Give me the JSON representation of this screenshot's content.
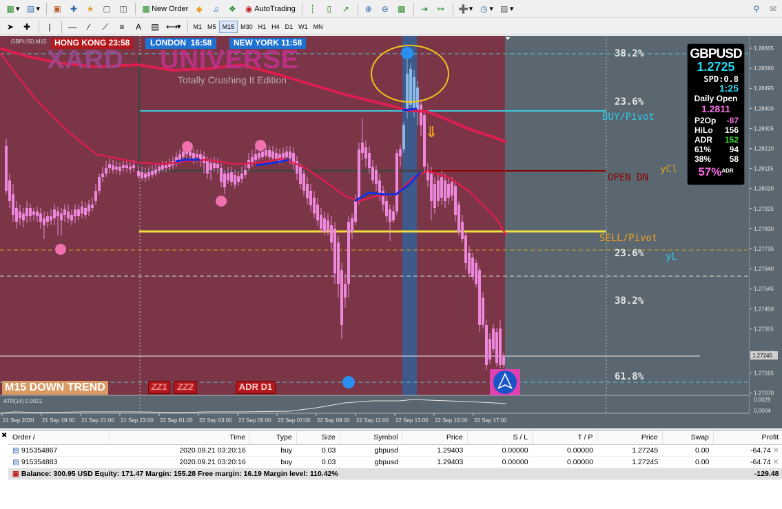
{
  "toolbar": {
    "new_order": "New Order",
    "autotrading": "AutoTrading",
    "timeframes": [
      "M1",
      "M5",
      "M15",
      "M30",
      "H1",
      "H4",
      "D1",
      "W1",
      "MN"
    ],
    "active_timeframe": "M15"
  },
  "chart": {
    "symbol_label": "GBPUSD,M15",
    "logo_line1": "XARD",
    "logo_line2": "UNIVERSE",
    "logo_sub": "Totally Crushing It Edition",
    "sessions": [
      {
        "label": "HONG KONG 23:58",
        "color": "#b3181c"
      },
      {
        "label": "LONDON  16:58",
        "color": "#1e73d2"
      },
      {
        "label": "NEW YORK 11:58",
        "color": "#1e73d2"
      }
    ],
    "fib_labels": [
      "38.2%",
      "23.6%",
      "23.6%",
      "38.2%",
      "61.8%"
    ],
    "buy_pivot": "BUY/Pivot",
    "sell_pivot": "SELL/Pivot",
    "open_dn": "OPEN DN",
    "yclose": "yCl",
    "ylow": "yL",
    "trend_label": "M15 DOWN TREND",
    "zz1": "ZZ1",
    "zz2": "ZZ2",
    "adr_d1": "ADR D1",
    "atr_label": "ATR(14) 0.0021",
    "price_axis": [
      "1.28665",
      "1.28590",
      "1.28495",
      "1.28400",
      "1.28305",
      "1.28210",
      "1.28115",
      "1.28020",
      "1.27925",
      "1.27830",
      "1.27735",
      "1.27640",
      "1.27545",
      "1.27450",
      "1.27355",
      "1.27245",
      "1.27165",
      "1.27070"
    ],
    "current_price": "1.27245",
    "atr_axis": [
      "0.0029",
      "0.0004"
    ],
    "time_axis": [
      "21 Sep 2020",
      "21 Sep 19:00",
      "21 Sep 21:00",
      "21 Sep 23:00",
      "22 Sep 01:00",
      "22 Sep 03:00",
      "22 Sep 05:00",
      "22 Sep 07:00",
      "22 Sep 09:00",
      "22 Sep 11:00",
      "22 Sep 13:00",
      "22 Sep 15:00",
      "22 Sep 17:00"
    ],
    "colors": {
      "bg_red": "#7a3646",
      "bg_grey": "#5a6770",
      "candle": "#ee88dd",
      "ma_red": "#dc1e50",
      "ma_blue": "#1030e0"
    }
  },
  "info_panel": {
    "symbol": "GBPUSD",
    "price": "1.2725",
    "spread": "SPD:0.8",
    "timer": "1:25",
    "daily_open_label": "Daily Open",
    "daily_open": "1.2811",
    "rows": [
      {
        "k": "P2Op",
        "v": "-87",
        "color": "#ff6ee6"
      },
      {
        "k": "HiLo",
        "v": "156",
        "color": "#ffffff"
      },
      {
        "k": "ADR",
        "v": "152",
        "color": "#33dd33"
      },
      {
        "k": "61%",
        "v": "94",
        "color": "#ffffff"
      },
      {
        "k": "38%",
        "v": "58",
        "color": "#ffffff"
      }
    ],
    "adr_pct": "57%",
    "adr_suffix": "ADR"
  },
  "terminal": {
    "columns": [
      "Order",
      "Time",
      "Type",
      "Size",
      "Symbol",
      "Price",
      "S / L",
      "T / P",
      "Price",
      "Swap",
      "Profit"
    ],
    "orders": [
      {
        "order": "915354867",
        "time": "2020.09.21 03:20:16",
        "type": "buy",
        "size": "0.03",
        "symbol": "gbpusd",
        "price": "1.29403",
        "sl": "0.00000",
        "tp": "0.00000",
        "cur": "1.27245",
        "swap": "0.00",
        "profit": "-64.74"
      },
      {
        "order": "915354883",
        "time": "2020.09.21 03:20:16",
        "type": "buy",
        "size": "0.03",
        "symbol": "gbpusd",
        "price": "1.29403",
        "sl": "0.00000",
        "tp": "0.00000",
        "cur": "1.27245",
        "swap": "0.00",
        "profit": "-64.74"
      }
    ],
    "balance_line": "Balance: 300.95 USD  Equity: 171.47  Margin: 155.28  Free margin: 16.19  Margin level: 110.42%",
    "total_profit": "-129.48"
  }
}
